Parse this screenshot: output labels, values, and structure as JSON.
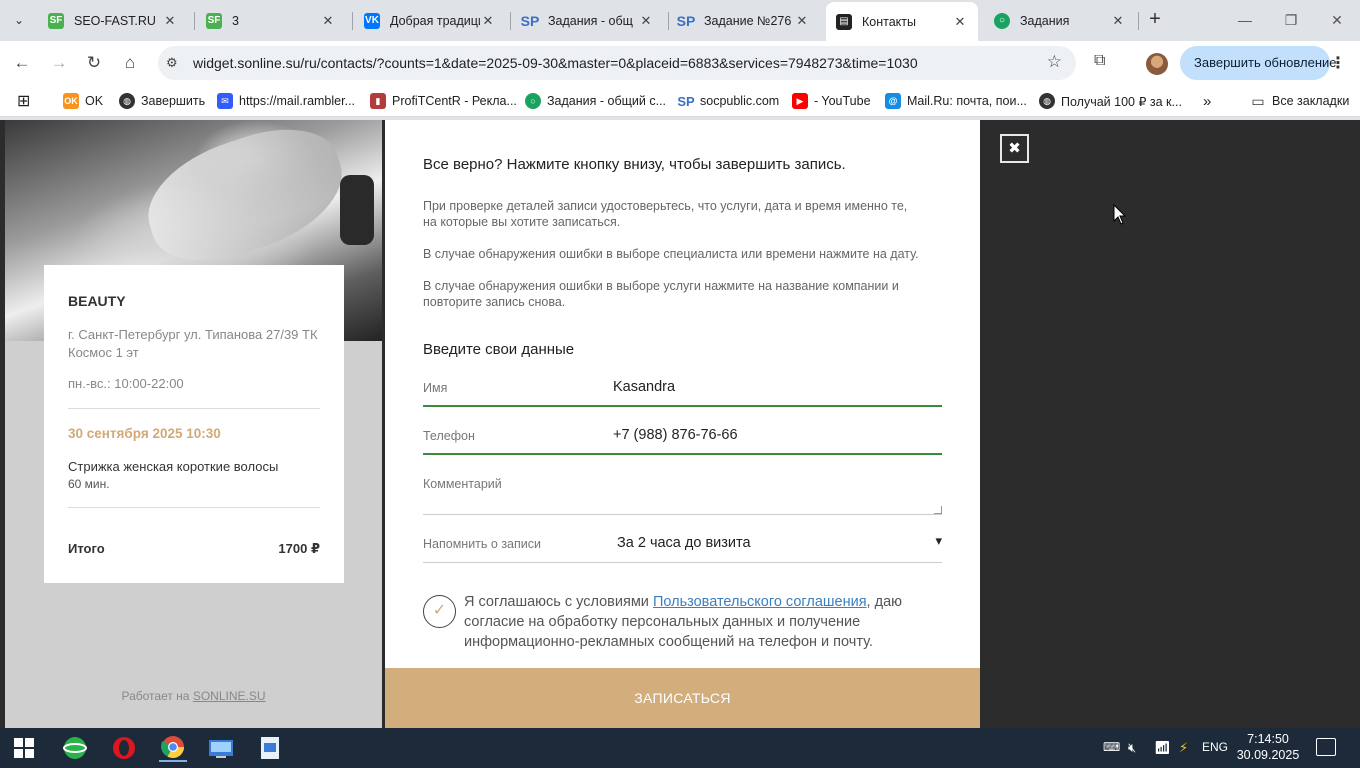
{
  "browser": {
    "tabs": [
      {
        "title": "SEO-FAST.RU",
        "icon": "seofast-icon",
        "color": "#4caf50"
      },
      {
        "title": "3",
        "icon": "seofast-icon",
        "color": "#4caf50"
      },
      {
        "title": "Добрая традиция",
        "icon": "vk-icon",
        "color": "#0077ff"
      },
      {
        "title": "Задания - общ",
        "icon": "socpublic-icon",
        "color": "#3d6fc2"
      },
      {
        "title": "Задание №276",
        "icon": "socpublic-icon",
        "color": "#3d6fc2"
      },
      {
        "title": "Контакты",
        "icon": "sonline-icon",
        "color": "#222222",
        "active": true
      },
      {
        "title": "Задания",
        "icon": "green-circle-icon",
        "color": "#1aa260"
      }
    ],
    "url": "widget.sonline.su/ru/contacts/?counts=1&date=2025-09-30&master=0&placeid=6883&services=7948273&time=1030",
    "update_button": "Завершить обновление",
    "bookmarks": [
      {
        "label": "OK",
        "icon": "ok-icon",
        "color": "#f7931e"
      },
      {
        "label": "Завершить",
        "icon": "globe-icon",
        "color": "#333333"
      },
      {
        "label": "https://mail.rambler...",
        "icon": "mail-icon",
        "color": "#315efb"
      },
      {
        "label": "ProfiTCentR - Рекла...",
        "icon": "chart-icon",
        "color": "#b23b3b"
      },
      {
        "label": "Задания - общий с...",
        "icon": "green-circle-icon",
        "color": "#1aa260"
      },
      {
        "label": "socpublic.com",
        "icon": "socpublic-icon",
        "color": "#3d6fc2"
      },
      {
        "label": "- YouTube",
        "icon": "youtube-icon",
        "color": "#ff0000"
      },
      {
        "label": "Mail.Ru: почта, пои...",
        "icon": "mailru-icon",
        "color": "#168de2"
      },
      {
        "label": "Получай 100 ₽ за к...",
        "icon": "globe-icon",
        "color": "#333333"
      }
    ],
    "all_bookmarks": "Все закладки"
  },
  "salon": {
    "name": "BEAUTY",
    "address": "г. Санкт-Петербург ул. Типанова 27/39 ТК Космос 1 эт",
    "hours": "пн.-вс.: 10:00-22:00",
    "datetime": "30 сентября 2025 10:30",
    "service": "Стрижка женская короткие волосы",
    "duration": "60 мин.",
    "total_label": "Итого",
    "total_value": "1700 ₽",
    "powered_prefix": "Работает на",
    "powered_link": "SONLINE.SU"
  },
  "form": {
    "confirm_heading": "Все верно? Нажмите кнопку внизу, чтобы завершить запись.",
    "note1": "При проверке деталей записи удостоверьтесь, что услуги, дата и время именно те, на которые вы хотите записаться.",
    "note2": "В случае обнаружения ошибки в выборе специалиста или времени нажмите на дату.",
    "note3": "В случае обнаружения ошибки в выборе услуги нажмите на название компании и повторите запись снова.",
    "section_heading": "Введите свои данные",
    "name_label": "Имя",
    "name_value": "Kasandra",
    "phone_label": "Телефон",
    "phone_value": "+7 (988) 876-76-66",
    "comment_label": "Комментарий",
    "comment_value": "",
    "remind_label": "Напомнить о записи",
    "remind_value": "За 2 часа до визита",
    "agree_prefix": "Я соглашаюсь с условиями ",
    "agree_link": "Пользовательского соглашения",
    "agree_suffix": ", даю согласие на обработку персональных данных и получение информационно-рекламных сообщений на телефон и почту.",
    "submit": "ЗАПИСАТЬСЯ"
  },
  "colors": {
    "accent": "#d2ae7c",
    "date_color": "#d2a977",
    "valid_line": "#3b8a3b",
    "link": "#3b7fbf"
  },
  "taskbar": {
    "lang": "ENG",
    "time": "7:14:50",
    "date": "30.09.2025"
  }
}
